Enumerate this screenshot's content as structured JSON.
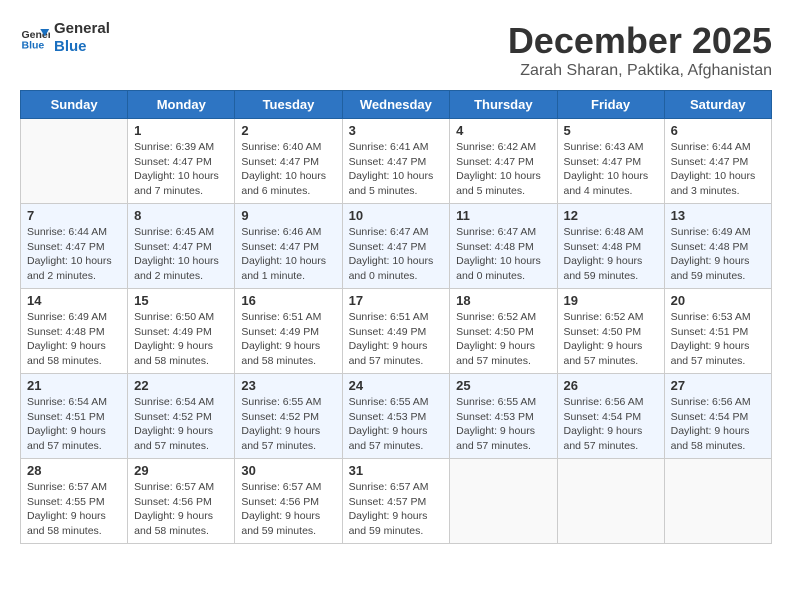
{
  "header": {
    "logo_line1": "General",
    "logo_line2": "Blue",
    "month": "December 2025",
    "location": "Zarah Sharan, Paktika, Afghanistan"
  },
  "days_of_week": [
    "Sunday",
    "Monday",
    "Tuesday",
    "Wednesday",
    "Thursday",
    "Friday",
    "Saturday"
  ],
  "weeks": [
    [
      {
        "day": "",
        "content": ""
      },
      {
        "day": "1",
        "content": "Sunrise: 6:39 AM\nSunset: 4:47 PM\nDaylight: 10 hours\nand 7 minutes."
      },
      {
        "day": "2",
        "content": "Sunrise: 6:40 AM\nSunset: 4:47 PM\nDaylight: 10 hours\nand 6 minutes."
      },
      {
        "day": "3",
        "content": "Sunrise: 6:41 AM\nSunset: 4:47 PM\nDaylight: 10 hours\nand 5 minutes."
      },
      {
        "day": "4",
        "content": "Sunrise: 6:42 AM\nSunset: 4:47 PM\nDaylight: 10 hours\nand 5 minutes."
      },
      {
        "day": "5",
        "content": "Sunrise: 6:43 AM\nSunset: 4:47 PM\nDaylight: 10 hours\nand 4 minutes."
      },
      {
        "day": "6",
        "content": "Sunrise: 6:44 AM\nSunset: 4:47 PM\nDaylight: 10 hours\nand 3 minutes."
      }
    ],
    [
      {
        "day": "7",
        "content": "Sunrise: 6:44 AM\nSunset: 4:47 PM\nDaylight: 10 hours\nand 2 minutes."
      },
      {
        "day": "8",
        "content": "Sunrise: 6:45 AM\nSunset: 4:47 PM\nDaylight: 10 hours\nand 2 minutes."
      },
      {
        "day": "9",
        "content": "Sunrise: 6:46 AM\nSunset: 4:47 PM\nDaylight: 10 hours\nand 1 minute."
      },
      {
        "day": "10",
        "content": "Sunrise: 6:47 AM\nSunset: 4:47 PM\nDaylight: 10 hours\nand 0 minutes."
      },
      {
        "day": "11",
        "content": "Sunrise: 6:47 AM\nSunset: 4:48 PM\nDaylight: 10 hours\nand 0 minutes."
      },
      {
        "day": "12",
        "content": "Sunrise: 6:48 AM\nSunset: 4:48 PM\nDaylight: 9 hours\nand 59 minutes."
      },
      {
        "day": "13",
        "content": "Sunrise: 6:49 AM\nSunset: 4:48 PM\nDaylight: 9 hours\nand 59 minutes."
      }
    ],
    [
      {
        "day": "14",
        "content": "Sunrise: 6:49 AM\nSunset: 4:48 PM\nDaylight: 9 hours\nand 58 minutes."
      },
      {
        "day": "15",
        "content": "Sunrise: 6:50 AM\nSunset: 4:49 PM\nDaylight: 9 hours\nand 58 minutes."
      },
      {
        "day": "16",
        "content": "Sunrise: 6:51 AM\nSunset: 4:49 PM\nDaylight: 9 hours\nand 58 minutes."
      },
      {
        "day": "17",
        "content": "Sunrise: 6:51 AM\nSunset: 4:49 PM\nDaylight: 9 hours\nand 57 minutes."
      },
      {
        "day": "18",
        "content": "Sunrise: 6:52 AM\nSunset: 4:50 PM\nDaylight: 9 hours\nand 57 minutes."
      },
      {
        "day": "19",
        "content": "Sunrise: 6:52 AM\nSunset: 4:50 PM\nDaylight: 9 hours\nand 57 minutes."
      },
      {
        "day": "20",
        "content": "Sunrise: 6:53 AM\nSunset: 4:51 PM\nDaylight: 9 hours\nand 57 minutes."
      }
    ],
    [
      {
        "day": "21",
        "content": "Sunrise: 6:54 AM\nSunset: 4:51 PM\nDaylight: 9 hours\nand 57 minutes."
      },
      {
        "day": "22",
        "content": "Sunrise: 6:54 AM\nSunset: 4:52 PM\nDaylight: 9 hours\nand 57 minutes."
      },
      {
        "day": "23",
        "content": "Sunrise: 6:55 AM\nSunset: 4:52 PM\nDaylight: 9 hours\nand 57 minutes."
      },
      {
        "day": "24",
        "content": "Sunrise: 6:55 AM\nSunset: 4:53 PM\nDaylight: 9 hours\nand 57 minutes."
      },
      {
        "day": "25",
        "content": "Sunrise: 6:55 AM\nSunset: 4:53 PM\nDaylight: 9 hours\nand 57 minutes."
      },
      {
        "day": "26",
        "content": "Sunrise: 6:56 AM\nSunset: 4:54 PM\nDaylight: 9 hours\nand 57 minutes."
      },
      {
        "day": "27",
        "content": "Sunrise: 6:56 AM\nSunset: 4:54 PM\nDaylight: 9 hours\nand 58 minutes."
      }
    ],
    [
      {
        "day": "28",
        "content": "Sunrise: 6:57 AM\nSunset: 4:55 PM\nDaylight: 9 hours\nand 58 minutes."
      },
      {
        "day": "29",
        "content": "Sunrise: 6:57 AM\nSunset: 4:56 PM\nDaylight: 9 hours\nand 58 minutes."
      },
      {
        "day": "30",
        "content": "Sunrise: 6:57 AM\nSunset: 4:56 PM\nDaylight: 9 hours\nand 59 minutes."
      },
      {
        "day": "31",
        "content": "Sunrise: 6:57 AM\nSunset: 4:57 PM\nDaylight: 9 hours\nand 59 minutes."
      },
      {
        "day": "",
        "content": ""
      },
      {
        "day": "",
        "content": ""
      },
      {
        "day": "",
        "content": ""
      }
    ]
  ]
}
